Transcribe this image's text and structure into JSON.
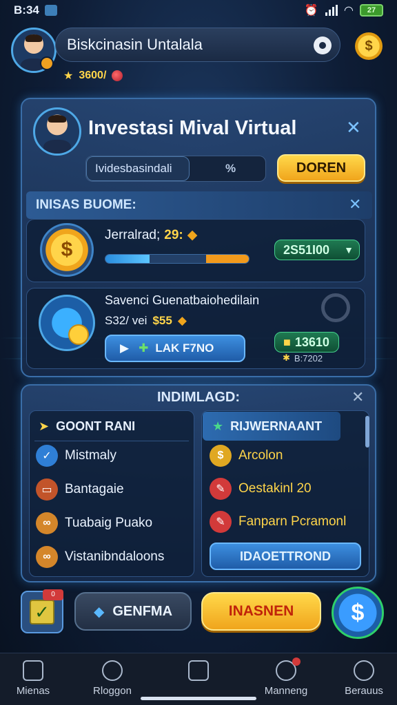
{
  "status_bar": {
    "time": "B:34"
  },
  "header": {
    "name": "Biskcinasin Untalala",
    "points": "3600/"
  },
  "main_panel": {
    "title": "Investasi Mival Virtual",
    "field_value": "Ividesbasindali",
    "field_percent": "%",
    "open_button": "DOREN"
  },
  "section": {
    "title": "INISAS BUOME:",
    "card1": {
      "label": "Jerralrad;",
      "value": "29:",
      "amount": "2S51I00",
      "progress_fraction": 0.31
    },
    "card2": {
      "title": "Savenci Guenatbaiohedilain",
      "price_prefix": "S32/ vei",
      "price_value": "$55",
      "button_label": "LAK F7NO",
      "badge_value": "13610",
      "badge_sub": "B:7202"
    }
  },
  "lists_panel": {
    "title": "INDIMLAGD:",
    "left": {
      "header": "GOONT RANI",
      "items": [
        {
          "label": "Mistmaly",
          "icon": "check-icon",
          "color": "#2f7fd6"
        },
        {
          "label": "Bantagaie",
          "icon": "card-icon",
          "color": "#c2542a"
        },
        {
          "label": "Tuabaig Puako",
          "icon": "link-icon",
          "color": "#d4862a"
        },
        {
          "label": "Vistanibndaloons",
          "icon": "link-icon",
          "color": "#d4862a"
        }
      ]
    },
    "right": {
      "header": "RIJWERNAANT",
      "items": [
        {
          "label": "Arcolon",
          "icon": "coin-icon",
          "color": "#e0a822"
        },
        {
          "label": "Oestakinl 20",
          "icon": "pencil-icon",
          "color": "#d23a3a"
        },
        {
          "label": "Fanparn Pcramonl",
          "icon": "pencil-icon",
          "color": "#d23a3a"
        }
      ],
      "button": "IDAOETTROND"
    }
  },
  "actions": {
    "badge": "0",
    "secondary": "GENFMA",
    "primary": "INASNEN",
    "dollar": "$"
  },
  "nav": {
    "items": [
      {
        "label": "Mienas",
        "icon": "home-icon"
      },
      {
        "label": "Rloggon",
        "icon": "globe-icon"
      },
      {
        "label": "",
        "icon": "grid-icon"
      },
      {
        "label": "Manneng",
        "icon": "refresh-icon"
      },
      {
        "label": "Berauus",
        "icon": "profile-icon"
      }
    ]
  }
}
